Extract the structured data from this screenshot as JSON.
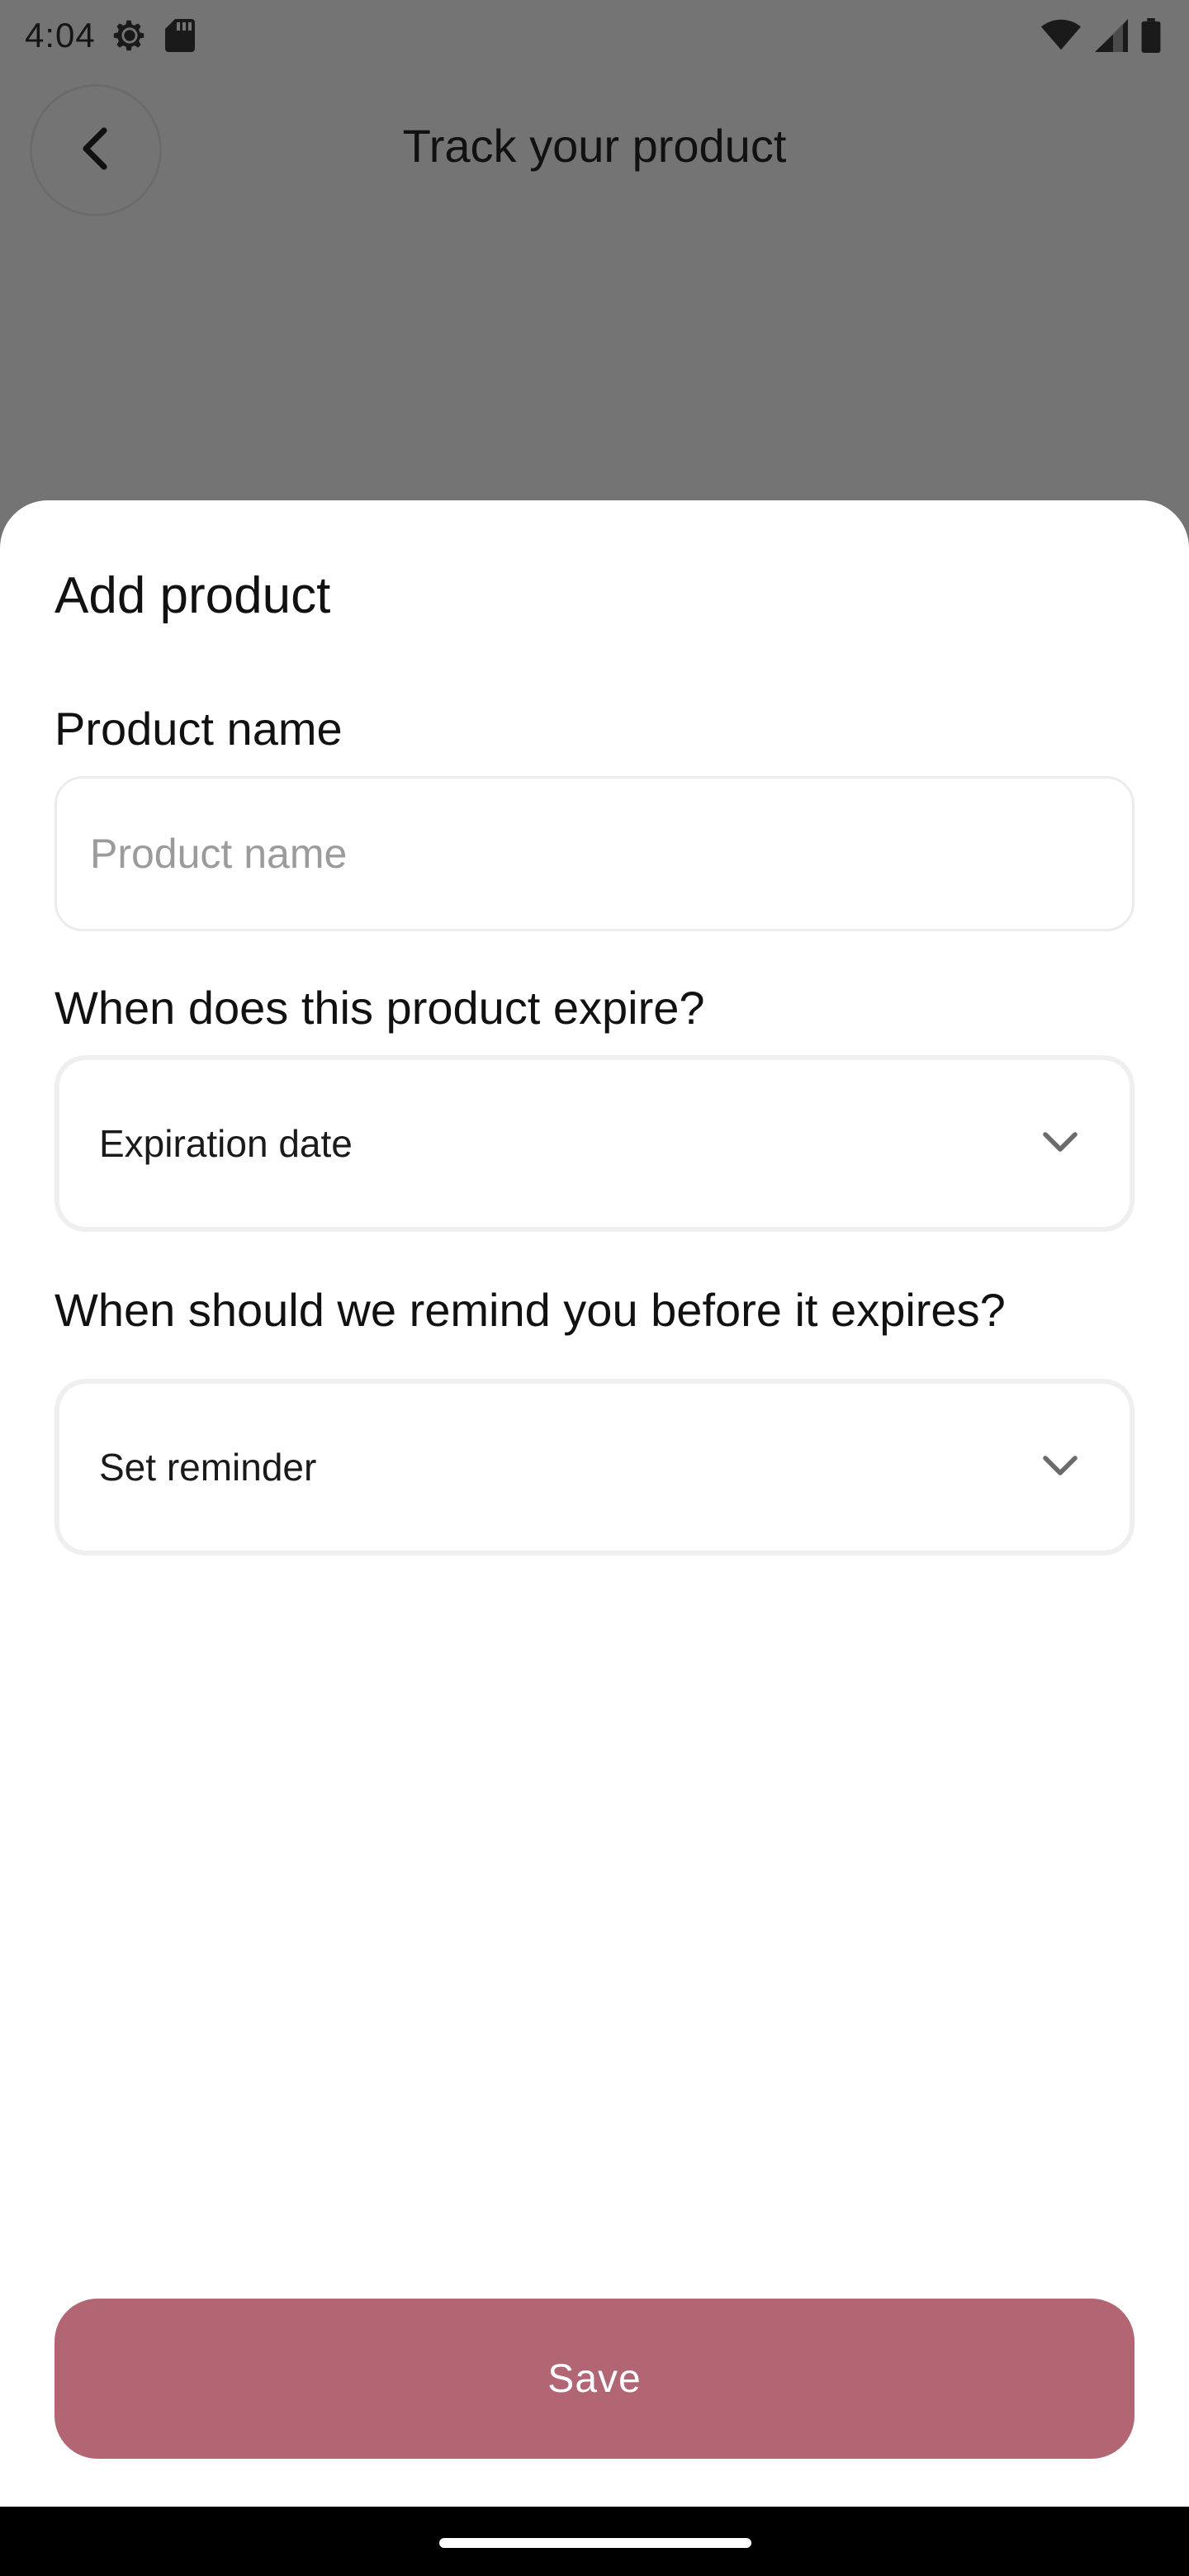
{
  "status_bar": {
    "time": "4:04",
    "icons": [
      "settings-gear-icon",
      "sd-card-icon",
      "wifi-icon",
      "cell-signal-icon",
      "battery-icon"
    ]
  },
  "header": {
    "title": "Track your product",
    "back_icon": "chevron-left-icon"
  },
  "sheet": {
    "title": "Add product",
    "product_name": {
      "label": "Product name",
      "value": "",
      "placeholder": "Product name"
    },
    "expiration": {
      "label": "When does this product expire?",
      "value": "Expiration date",
      "icon": "chevron-down-icon"
    },
    "reminder": {
      "label": "When should we remind you before it expires?",
      "value": "Set reminder",
      "icon": "chevron-down-icon"
    },
    "save_label": "Save"
  },
  "colors": {
    "accent": "#b26572",
    "overlay": "#747474",
    "sheet_background": "#ffffff"
  }
}
